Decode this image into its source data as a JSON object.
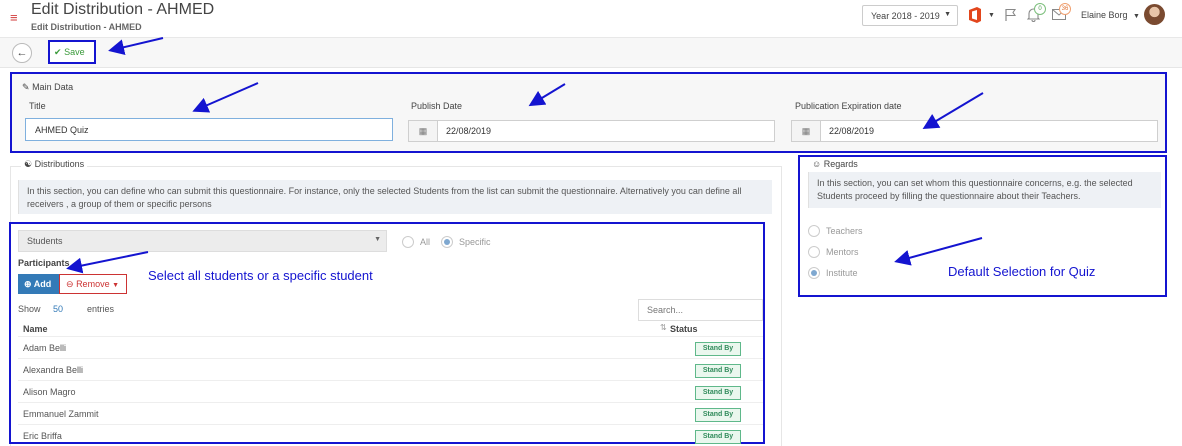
{
  "header": {
    "title": "Edit Distribution - AHMED",
    "subtitle": "Edit Distribution - AHMED",
    "year_selector": "Year 2018 - 2019",
    "notification_count": "0",
    "message_count": "36",
    "user_name": "Elaine Borg",
    "icons": [
      "hamburger-menu-icon",
      "office-icon",
      "flag-icon",
      "bell-icon",
      "mail-icon"
    ]
  },
  "toolbar": {
    "back_glyph": "←",
    "save_label": "Save"
  },
  "main_data": {
    "section_title": "Main Data",
    "title_label": "Title",
    "title_value": "AHMED Quiz",
    "publish_date_label": "Publish Date",
    "publish_date_value": "22/08/2019",
    "expiration_label": "Publication Expiration date",
    "expiration_value": "22/08/2019"
  },
  "distributions": {
    "section_title": "Distributions",
    "info_text": "In this section, you can define who can submit this questionnaire. For instance, only the selected Students from the list can submit the questionnaire. Alternatively you can define all receivers , a group of them or specific persons",
    "receiver_select": "Students",
    "radio_all": "All",
    "radio_specific": "Specific",
    "selected_radio": "Specific",
    "participants_label": "Participants",
    "add_label": "Add",
    "remove_label": "Remove",
    "show_label": "Show",
    "show_count": "50",
    "entries_label": "entries",
    "search_placeholder": "Search...",
    "col_name": "Name",
    "col_status": "Status",
    "rows": [
      {
        "name": "Adam Belli",
        "status": "Stand By"
      },
      {
        "name": "Alexandra Belli",
        "status": "Stand By"
      },
      {
        "name": "Alison Magro",
        "status": "Stand By"
      },
      {
        "name": "Emmanuel Zammit",
        "status": "Stand By"
      },
      {
        "name": "Eric Briffa",
        "status": "Stand By"
      }
    ]
  },
  "regards": {
    "section_title": "Regards",
    "info_text": "In this section, you can set whom this questionnaire concerns, e.g. the selected Students proceed by filling the questionnaire about their Teachers.",
    "options": [
      "Teachers",
      "Mentors",
      "Institute"
    ],
    "selected": "Institute"
  },
  "annotations": {
    "participants_note": "Select all students or a specific student",
    "regards_note": "Default Selection for Quiz",
    "color": "#1414d0"
  },
  "colors": {
    "accent": "#337ab7",
    "save_green": "#3a9a3a",
    "remove_red": "#cc3333",
    "status_green": "#2f8a5a"
  }
}
